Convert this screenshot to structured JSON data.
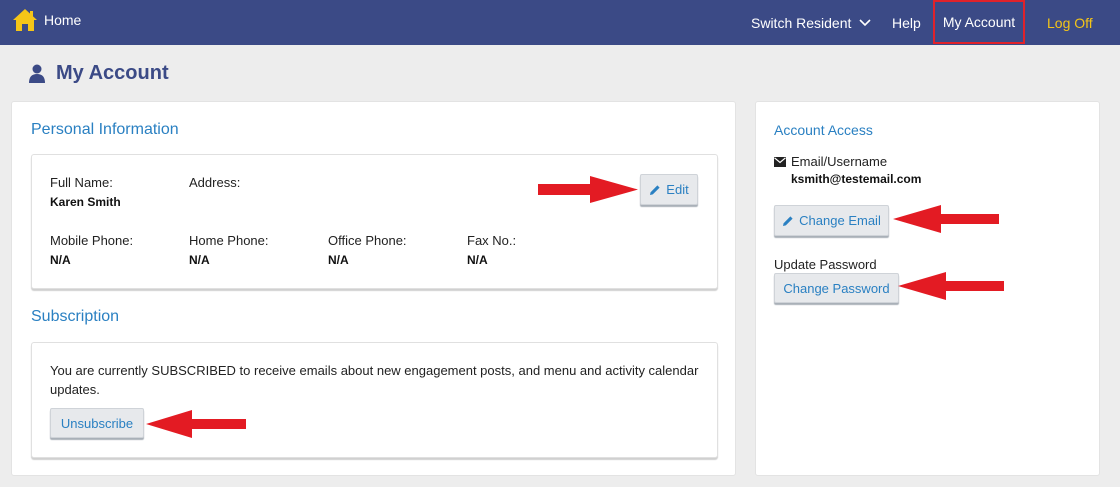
{
  "nav": {
    "home_label": "Home",
    "switch_resident_label": "Switch Resident",
    "help_label": "Help",
    "my_account_label": "My Account",
    "log_off_label": "Log Off",
    "highlight_color": "#e0222a",
    "logoff_color": "#f5c518",
    "bar_color": "#3b4a86"
  },
  "page": {
    "title": "My Account",
    "title_icon": "user-icon"
  },
  "personal": {
    "heading": "Personal Information",
    "full_name_label": "Full Name:",
    "full_name_value": "Karen Smith",
    "address_label": "Address:",
    "address_value": "",
    "mobile_label": "Mobile Phone:",
    "mobile_value": "N/A",
    "home_phone_label": "Home Phone:",
    "home_phone_value": "N/A",
    "office_phone_label": "Office Phone:",
    "office_phone_value": "N/A",
    "fax_label": "Fax No.:",
    "fax_value": "N/A",
    "edit_label": "Edit"
  },
  "subscription": {
    "heading": "Subscription",
    "text": "You are currently SUBSCRIBED to receive emails about new engagement posts, and menu and activity calendar updates.",
    "unsubscribe_label": "Unsubscribe"
  },
  "account_access": {
    "heading": "Account Access",
    "email_label": "Email/Username",
    "email_value": "ksmith@testemail.com",
    "change_email_label": "Change Email",
    "update_password_label": "Update Password",
    "change_password_label": "Change Password"
  },
  "annotation": {
    "arrow_color": "#e31b23"
  }
}
